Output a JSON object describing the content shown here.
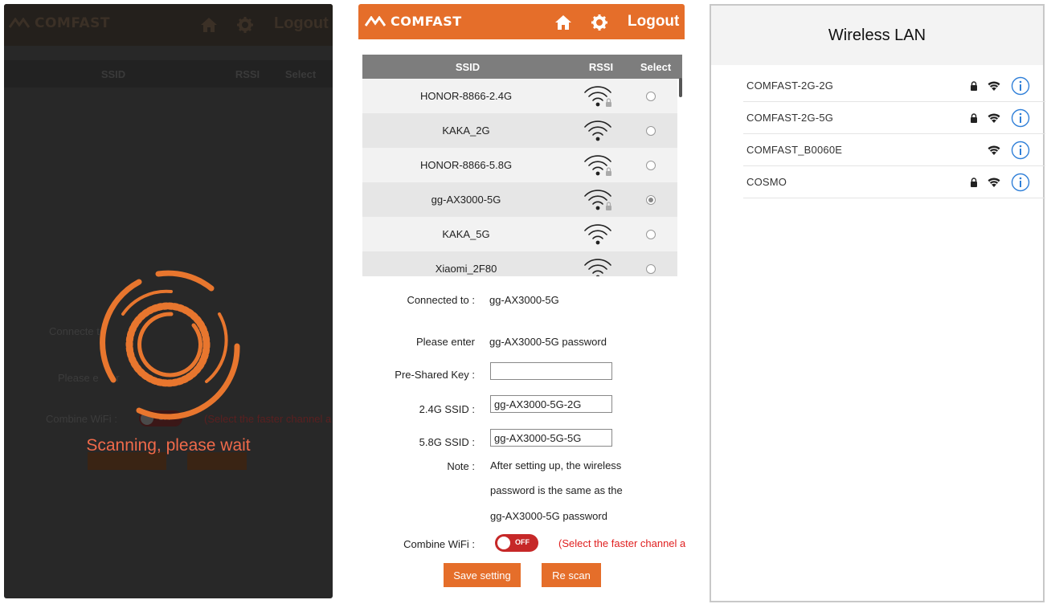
{
  "brand": "COMFAST",
  "logout_label": "Logout",
  "table_headers": {
    "ssid": "SSID",
    "rssi": "RSSI",
    "select": "Select"
  },
  "networks": [
    {
      "ssid": "HONOR-8866-2.4G",
      "locked": true,
      "selected": false
    },
    {
      "ssid": "KAKA_2G",
      "locked": false,
      "selected": false
    },
    {
      "ssid": "HONOR-8866-5.8G",
      "locked": true,
      "selected": false
    },
    {
      "ssid": "gg-AX3000-5G",
      "locked": true,
      "selected": true
    },
    {
      "ssid": "KAKA_5G",
      "locked": false,
      "selected": false
    },
    {
      "ssid": "Xiaomi_2F80",
      "locked": false,
      "selected": false
    }
  ],
  "form": {
    "connected_label": "Connected to :",
    "connected_value": "gg-AX3000-5G",
    "please_enter_label": "Please enter",
    "please_enter_value": "gg-AX3000-5G password",
    "psk_label": "Pre-Shared Key :",
    "psk_value": "",
    "ssid24_label": "2.4G SSID :",
    "ssid24_value": "gg-AX3000-5G-2G",
    "ssid58_label": "5.8G SSID :",
    "ssid58_value": "gg-AX3000-5G-5G",
    "note_label": "Note :",
    "note_line1": "After setting up, the wireless",
    "note_line2": "password is the same as the",
    "note_line3": "gg-AX3000-5G password",
    "combine_label": "Combine WiFi :",
    "toggle_state": "OFF",
    "combine_note": "(Select the faster channel a",
    "save_button": "Save setting",
    "rescan_button": "Re scan"
  },
  "scanning": {
    "message": "Scanning, please wait",
    "dim_connected": "Connecte",
    "dim_connected_tail": "to",
    "dim_please": "Please e",
    "dim_please_tail": "er",
    "dim_combine": "Combine WiFi :",
    "dim_note": "(Select the faster channel a"
  },
  "ios": {
    "title": "Wireless LAN",
    "networks": [
      {
        "name": "COMFAST-2G-2G",
        "locked": true
      },
      {
        "name": "COMFAST-2G-5G",
        "locked": true
      },
      {
        "name": "COMFAST_B0060E",
        "locked": false
      },
      {
        "name": "COSMO",
        "locked": true
      }
    ]
  },
  "colors": {
    "accent": "#e56e2a",
    "toggle_off": "#c62828",
    "scan_text": "#f06a4a",
    "info_blue": "#2f7fd8"
  }
}
